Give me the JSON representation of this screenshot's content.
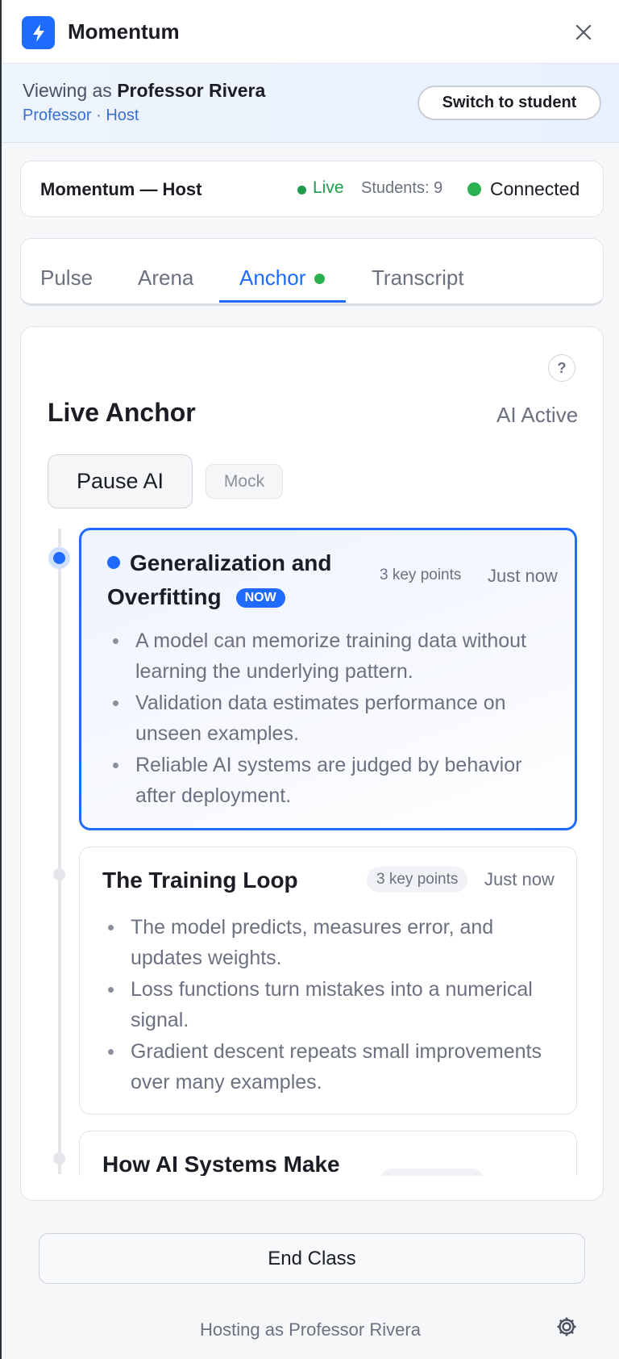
{
  "app": {
    "title": "Momentum"
  },
  "role": {
    "viewing_prefix": "Viewing as",
    "viewing_name": "Professor Rivera",
    "subtitle": "Professor · Host",
    "switch_label": "Switch to student"
  },
  "status": {
    "title": "Momentum — Host",
    "live_label": "Live",
    "students_label": "Students: 9",
    "connection_label": "Connected"
  },
  "tabs": [
    {
      "label": "Pulse"
    },
    {
      "label": "Arena"
    },
    {
      "label": "Anchor",
      "active": true
    },
    {
      "label": "Transcript"
    }
  ],
  "panel": {
    "title": "Live Anchor",
    "status": "AI Active",
    "pause_label": "Pause AI",
    "mock_label": "Mock",
    "help_label": "?"
  },
  "anchors": [
    {
      "title_line1": "Generalization and",
      "title_line2": "Overfitting",
      "badge": "NOW",
      "key_points": "3 key points",
      "time": "Just now",
      "points": [
        "A model can memorize training data without learning the underlying pattern.",
        "Validation data estimates performance on unseen examples.",
        "Reliable AI systems are judged by behavior after deployment."
      ]
    },
    {
      "title": "The Training Loop",
      "key_points": "3 key points",
      "time": "Just now",
      "points": [
        "The model predicts, measures error, and updates weights.",
        "Loss functions turn mistakes into a numerical signal.",
        "Gradient descent repeats small improvements over many examples."
      ]
    },
    {
      "title": "How AI Systems Make"
    }
  ],
  "footer": {
    "end_label": "End Class",
    "hosting_text": "Hosting as Professor Rivera"
  },
  "colors": {
    "accent": "#1f6bff",
    "live": "#1e9e4b",
    "connected": "#2bb04f"
  }
}
